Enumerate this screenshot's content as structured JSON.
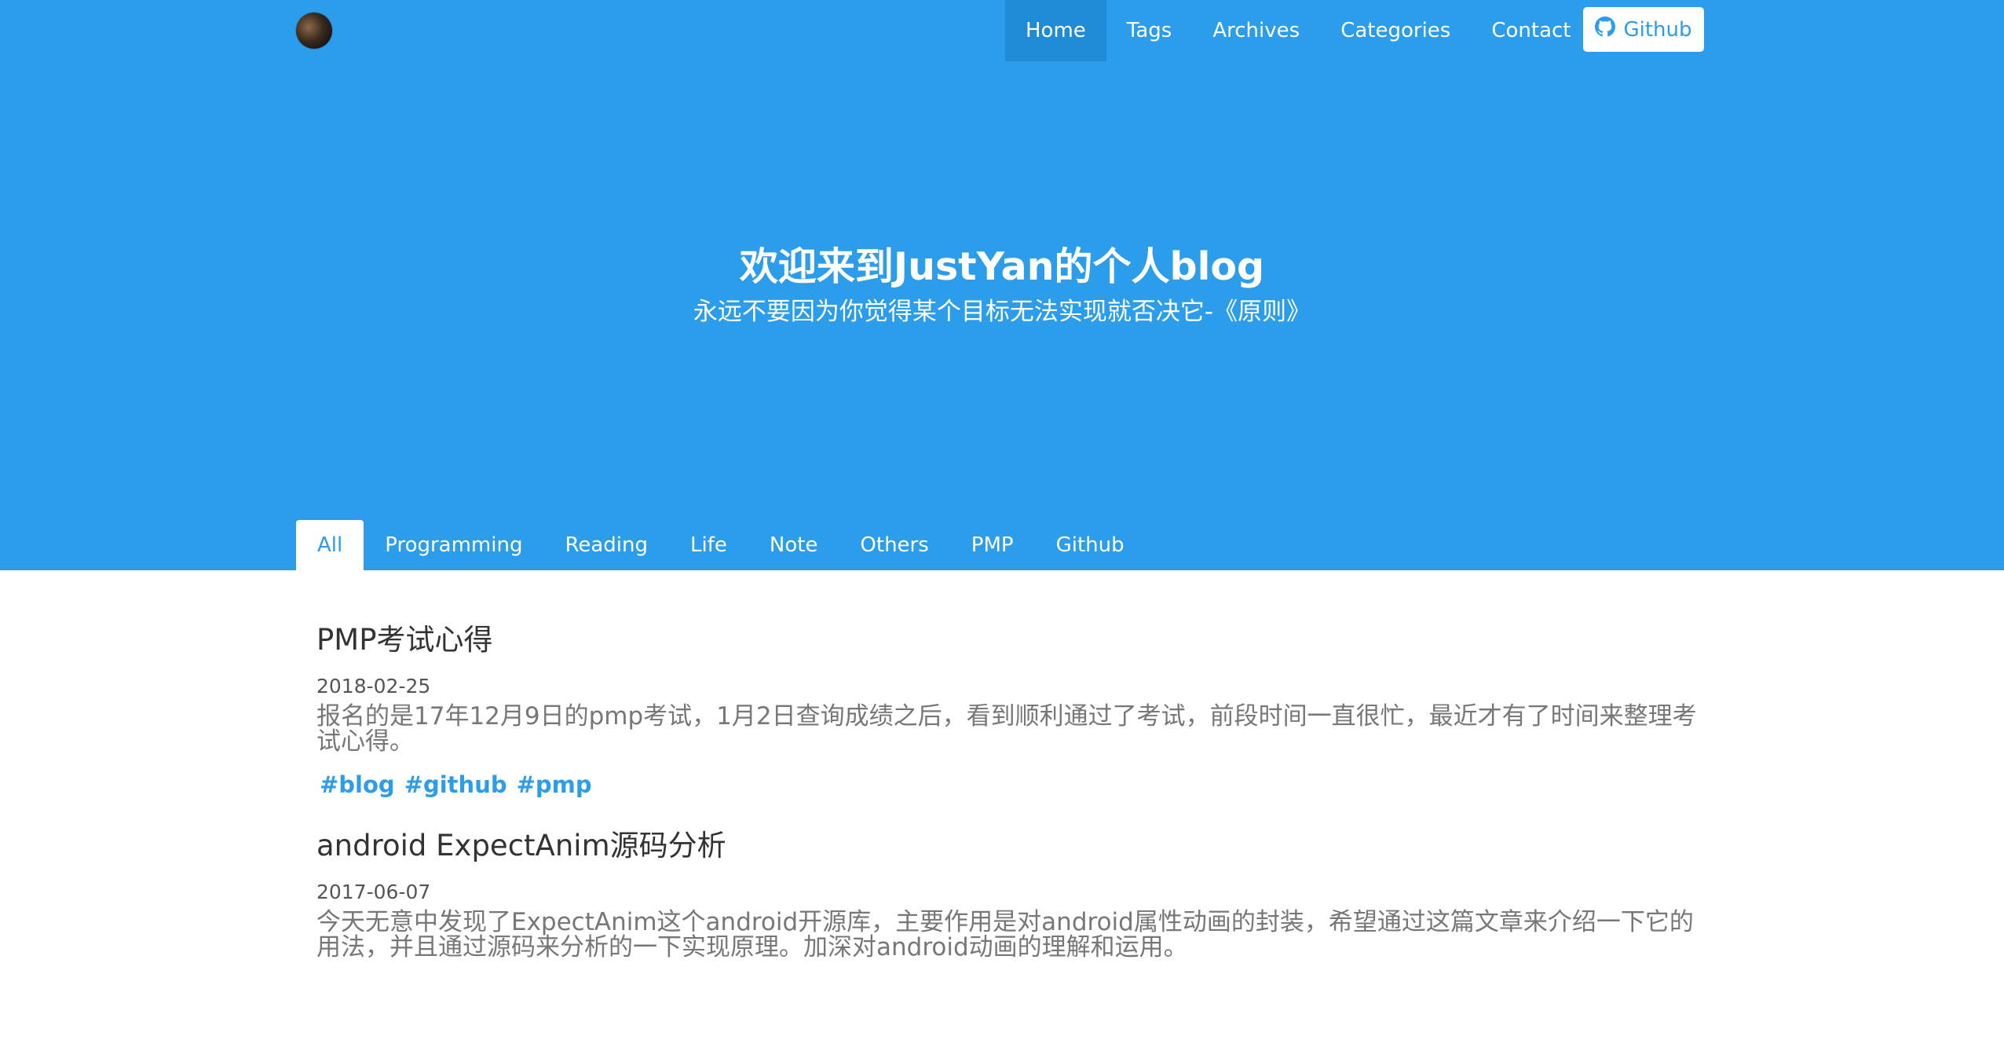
{
  "nav": {
    "items": [
      {
        "label": "Home"
      },
      {
        "label": "Tags"
      },
      {
        "label": "Archives"
      },
      {
        "label": "Categories"
      },
      {
        "label": "Contact"
      }
    ],
    "github_label": "Github",
    "github_icon": "github-icon"
  },
  "hero": {
    "title": "欢迎来到JustYan的个人blog",
    "subtitle": "永远不要因为你觉得某个目标无法实现就否决它-《原则》"
  },
  "tabs": [
    {
      "label": "All"
    },
    {
      "label": "Programming"
    },
    {
      "label": "Reading"
    },
    {
      "label": "Life"
    },
    {
      "label": "Note"
    },
    {
      "label": "Others"
    },
    {
      "label": "PMP"
    },
    {
      "label": "Github"
    }
  ],
  "posts": [
    {
      "title": "PMP考试心得",
      "date": "2018-02-25",
      "excerpt": "报名的是17年12月9日的pmp考试，1月2日查询成绩之后，看到顺利通过了考试，前段时间一直很忙，最近才有了时间来整理考试心得。",
      "tags": [
        "#blog",
        "#github",
        "#pmp"
      ]
    },
    {
      "title": "android ExpectAnim源码分析",
      "date": "2017-06-07",
      "excerpt": "今天无意中发现了ExpectAnim这个android开源库，主要作用是对android属性动画的封装，希望通过这篇文章来介绍一下它的用法，并且通过源码来分析的一下实现原理。加深对android动画的理解和运用。",
      "tags": []
    }
  ],
  "colors": {
    "primary": "#2b9dea",
    "nav_active": "#1f8bd6"
  }
}
